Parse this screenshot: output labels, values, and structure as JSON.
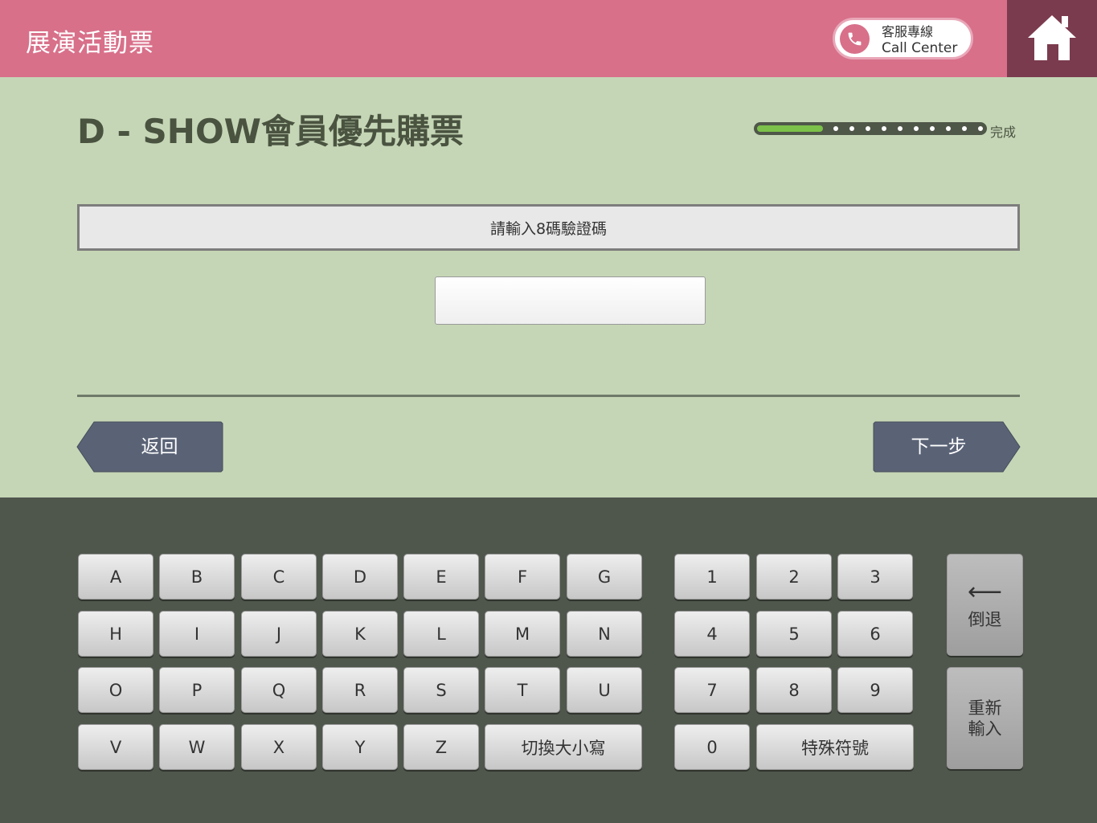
{
  "header": {
    "app_title": "展演活動票",
    "call_center_line1": "客服專線",
    "call_center_line2": "Call Center",
    "phone_icon": "phone-icon",
    "home_icon": "home-icon"
  },
  "page": {
    "title": "D - SHOW會員優先購票",
    "progress_label": "完成",
    "progress_fraction": 0.31,
    "progress_steps_remaining": 10,
    "prompt": "請輸入8碼驗證碼",
    "code_value": ""
  },
  "nav": {
    "back_label": "返回",
    "next_label": "下一步"
  },
  "keyboard": {
    "letters_row1": [
      "A",
      "B",
      "C",
      "D",
      "E",
      "F",
      "G"
    ],
    "letters_row2": [
      "H",
      "I",
      "J",
      "K",
      "L",
      "M",
      "N"
    ],
    "letters_row3": [
      "O",
      "P",
      "Q",
      "R",
      "S",
      "T",
      "U"
    ],
    "letters_row4": [
      "V",
      "W",
      "X",
      "Y",
      "Z"
    ],
    "case_toggle": "切換大小寫",
    "digits_row1": [
      "1",
      "2",
      "3"
    ],
    "digits_row2": [
      "4",
      "5",
      "6"
    ],
    "digits_row3": [
      "7",
      "8",
      "9"
    ],
    "digit_zero": "0",
    "special_symbols": "特殊符號",
    "backspace_arrow": "⟵",
    "backspace_label": "倒退",
    "reset_label_line1": "重新",
    "reset_label_line2": "輸入"
  },
  "colors": {
    "header": "#d8708a",
    "home_button": "#7b3b4e",
    "content_bg": "#c5d6b6",
    "keyboard_bg": "#4f564c",
    "nav_button": "#5a6376",
    "progress_fill": "#7cc14a"
  }
}
